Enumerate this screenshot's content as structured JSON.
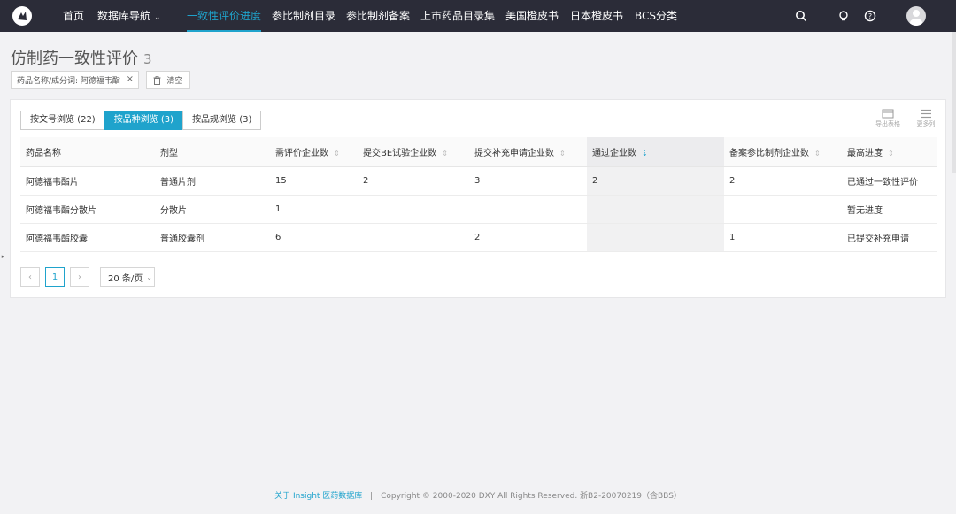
{
  "nav": {
    "items": [
      {
        "label": "首页"
      },
      {
        "label": "数据库导航"
      },
      {
        "label": "一致性评价进度"
      },
      {
        "label": "参比制剂目录"
      },
      {
        "label": "参比制剂备案"
      },
      {
        "label": "上市药品目录集"
      },
      {
        "label": "美国橙皮书"
      },
      {
        "label": "日本橙皮书"
      },
      {
        "label": "BCS分类"
      }
    ],
    "active_index": 2,
    "icons": [
      "search-icon",
      "lightbulb-icon",
      "help-icon",
      "user-avatar"
    ]
  },
  "page": {
    "title": "仿制药一致性评价",
    "count": "3"
  },
  "filter": {
    "chip_label": "药品名称/成分词: 阿德福韦酯",
    "clear_label": "清空"
  },
  "tabs": [
    {
      "label": "按文号浏览 (22)"
    },
    {
      "label": "按品种浏览 (3)"
    },
    {
      "label": "按品规浏览 (3)"
    }
  ],
  "active_tab": 1,
  "tools": {
    "export_label": "导出表格",
    "columns_label": "更多列"
  },
  "table": {
    "columns": [
      "药品名称",
      "剂型",
      "需评价企业数",
      "提交BE试验企业数",
      "提交补充申请企业数",
      "通过企业数",
      "备案参比制剂企业数",
      "最高进度"
    ],
    "sorted_column": "通过企业数",
    "rows": [
      {
        "name": "阿德福韦酯片",
        "form": "普通片剂",
        "need": "15",
        "be": "2",
        "supp": "3",
        "passed": "2",
        "ref": "2",
        "progress": "已通过一致性评价"
      },
      {
        "name": "阿德福韦酯分散片",
        "form": "分散片",
        "need": "1",
        "be": "",
        "supp": "",
        "passed": "",
        "ref": "",
        "progress": "暂无进度"
      },
      {
        "name": "阿德福韦酯胶囊",
        "form": "普通胶囊剂",
        "need": "6",
        "be": "",
        "supp": "2",
        "passed": "",
        "ref": "1",
        "progress": "已提交补充申请"
      }
    ]
  },
  "pager": {
    "prev": "‹",
    "current": "1",
    "next": "›",
    "page_size": "20 条/页"
  },
  "footer": {
    "link": "关于 Insight 医药数据库",
    "sep": "|",
    "copyright": "Copyright © 2000-2020 DXY All Rights Reserved. 浙B2-20070219（含BBS）"
  },
  "colors": {
    "nav_bg": "#2b2c38",
    "accent": "#1fa3cc",
    "page_bg": "#f2f2f4"
  }
}
